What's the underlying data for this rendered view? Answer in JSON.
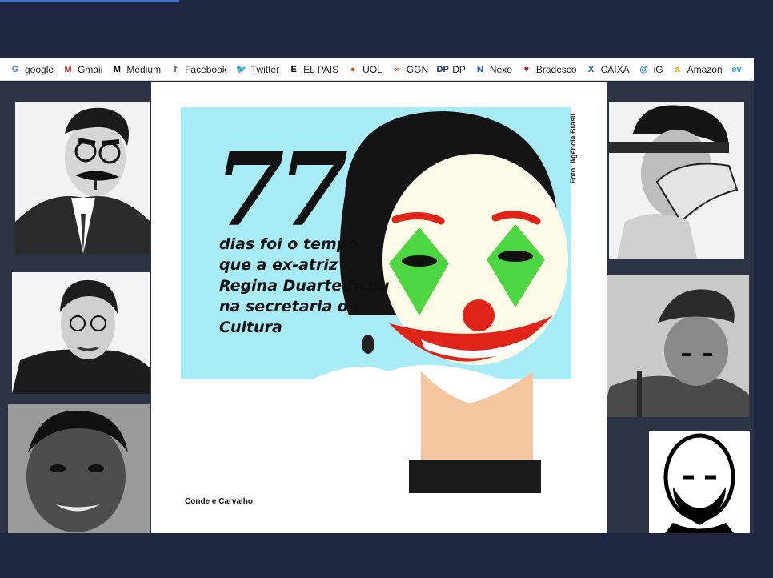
{
  "bookmarks": [
    {
      "label": "google",
      "icon": "google-icon",
      "glyph": "G",
      "color": "#4285f4"
    },
    {
      "label": "Gmail",
      "icon": "gmail-icon",
      "glyph": "M",
      "color": "#d93025"
    },
    {
      "label": "Medium",
      "icon": "medium-icon",
      "glyph": "M",
      "color": "#000000"
    },
    {
      "label": "Facebook",
      "icon": "facebook-icon",
      "glyph": "f",
      "color": "#3b5998"
    },
    {
      "label": "Twitter",
      "icon": "twitter-icon",
      "glyph": "🐦",
      "color": "#1da1f2"
    },
    {
      "label": "EL PAIS",
      "icon": "elpais-icon",
      "glyph": "E",
      "color": "#000000"
    },
    {
      "label": "UOL",
      "icon": "uol-icon",
      "glyph": "●",
      "color": "#c0541b"
    },
    {
      "label": "GGN",
      "icon": "ggn-icon",
      "glyph": "∞",
      "color": "#e8551e"
    },
    {
      "label": "DP",
      "icon": "dp-icon",
      "glyph": "DP",
      "color": "#14306e"
    },
    {
      "label": "Nexo",
      "icon": "nexo-icon",
      "glyph": "N",
      "color": "#2a5bd7"
    },
    {
      "label": "Bradesco",
      "icon": "bradesco-icon",
      "glyph": "♥",
      "color": "#cc092f"
    },
    {
      "label": "CAIXA",
      "icon": "caixa-icon",
      "glyph": "X",
      "color": "#1c60ab"
    },
    {
      "label": "iG",
      "icon": "ig-icon",
      "glyph": "@",
      "color": "#1f78c8"
    },
    {
      "label": "Amazon",
      "icon": "amazon-icon",
      "glyph": "a",
      "color": "#ff9900"
    },
    {
      "label": "",
      "icon": "ev-icon",
      "glyph": "ev",
      "color": "#29a3c7"
    }
  ],
  "cartoon": {
    "number": "77",
    "caption_lines": [
      "dias foi o tempo",
      "que a ex-atriz",
      "Regina Duarte ficou",
      "na secretaria da",
      "Cultura"
    ],
    "vertical_credit": "Foto: Agência Brasil",
    "signature": "Conde e Carvalho"
  },
  "colors": {
    "background": "#1f2640",
    "cartoon_bg": "#a7ecf7",
    "clown_green": "#39d12f",
    "clown_red": "#e02418"
  }
}
